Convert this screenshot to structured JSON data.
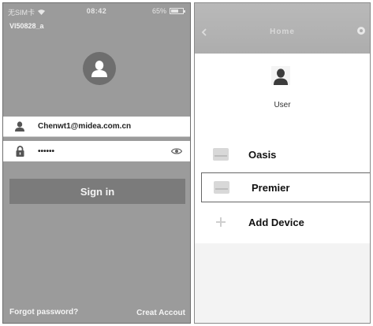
{
  "login": {
    "status_bar": {
      "carrier": "无SIM卡",
      "time": "08:42",
      "battery": "65%",
      "battery_level": 0.65
    },
    "device_id": "VI50828_a",
    "email_value": "Chenwt1@midea.com.cn",
    "password_masked": "••••••",
    "signin_label": "Sign in",
    "forgot_label": "Forgot password?",
    "create_label": "Creat Accout",
    "colors": {
      "background": "#9b9b9b",
      "button": "#7b7b7b",
      "avatar": "#6e6e6e"
    },
    "icons": [
      "wifi-icon",
      "battery-icon",
      "avatar-icon",
      "user-icon",
      "lock-icon",
      "eye-icon"
    ]
  },
  "home": {
    "header_title": "Home",
    "user_label": "User",
    "devices": [
      {
        "label": "Oasis"
      },
      {
        "label": "Premier"
      }
    ],
    "add_label": "Add Device",
    "icons": [
      "back-icon",
      "settings-icon",
      "user-avatar-icon",
      "ac-device-icon",
      "plus-icon"
    ]
  }
}
